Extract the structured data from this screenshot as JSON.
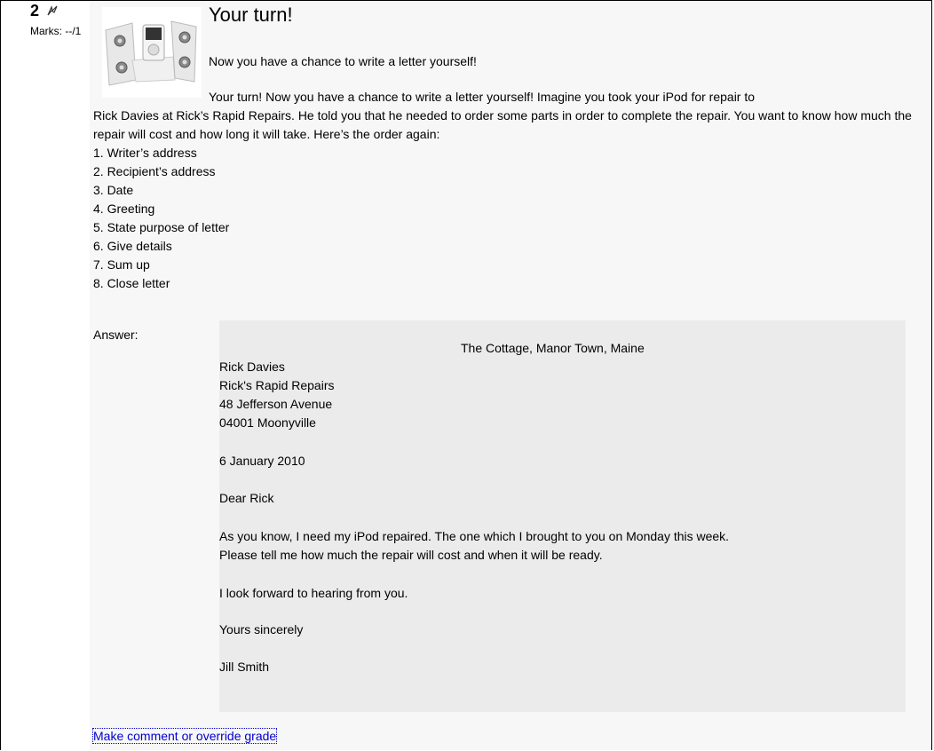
{
  "question": {
    "number": "2",
    "marks": "Marks: --/1",
    "image_alt": "iPod docking speaker",
    "title": "Your turn!",
    "intro": "Now you have a chance to write a letter yourself!",
    "body_first": "Your turn! Now you have a chance to write a letter yourself! Imagine you took your iPod for repair to",
    "body_rest": "Rick Davies at Rick’s Rapid Repairs. He told you that he needed to order some parts in order to complete the repair. You want to know how much the repair will cost and how long it will take. Here’s the order again:",
    "steps": [
      "1. Writer’s address",
      "2. Recipient’s address",
      "3. Date",
      "4. Greeting",
      "5. State purpose of letter",
      "6. Give details",
      "7. Sum up",
      "8. Close letter"
    ]
  },
  "answer": {
    "label": "Answer:",
    "writer_address": "The Cottage, Manor Town, Maine",
    "recipient": [
      "Rick Davies",
      "Rick's Rapid Repairs",
      "48 Jefferson Avenue",
      "04001 Moonyville"
    ],
    "date": "6 January 2010",
    "greeting": "Dear Rick",
    "purpose": [
      "As you know, I need my iPod repaired. The one which I brought to you on Monday this week.",
      "Please tell me how much the repair will cost and when it will be ready."
    ],
    "sum_up": "I look forward to hearing from you.",
    "closing": "Yours sincerely",
    "signature": "Jill Smith"
  },
  "comment_link": "Make comment or override grade"
}
